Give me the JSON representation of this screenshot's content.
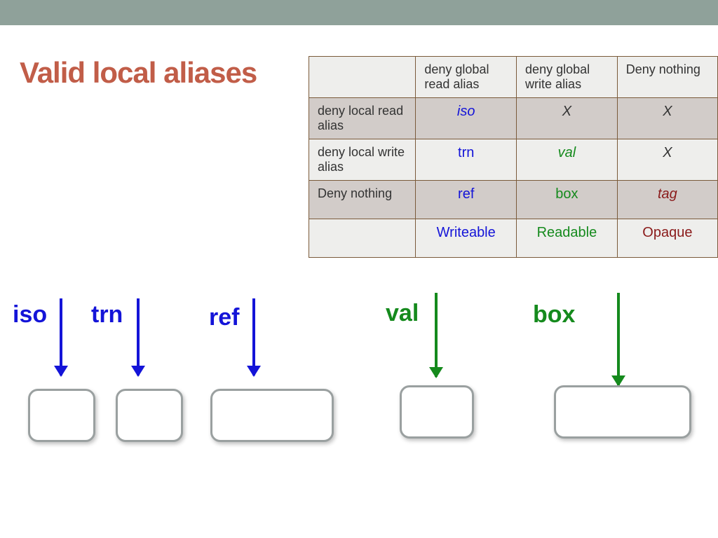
{
  "title": "Valid local aliases",
  "matrix": {
    "col_headers": [
      "deny global read alias",
      "deny global write alias",
      "Deny nothing"
    ],
    "rows": [
      {
        "label": "deny local read alias",
        "cells": [
          {
            "text": "iso",
            "color": "blue",
            "italic": true
          },
          {
            "text": "X",
            "color": "x"
          },
          {
            "text": "X",
            "color": "x"
          }
        ]
      },
      {
        "label": "deny local write alias",
        "cells": [
          {
            "text": "trn",
            "color": "blue"
          },
          {
            "text": "val",
            "color": "green",
            "italic": true
          },
          {
            "text": "X",
            "color": "x"
          }
        ]
      },
      {
        "label": "Deny nothing",
        "cells": [
          {
            "text": "ref",
            "color": "blue"
          },
          {
            "text": "box",
            "color": "green"
          },
          {
            "text": "tag",
            "color": "darkred",
            "italic": true
          }
        ]
      }
    ],
    "footer": [
      {
        "text": "Writeable",
        "color": "blue"
      },
      {
        "text": "Readable",
        "color": "green"
      },
      {
        "text": "Opaque",
        "color": "darkred"
      }
    ]
  },
  "capabilities": {
    "iso": "iso",
    "trn": "trn",
    "ref": "ref",
    "val": "val",
    "box": "box"
  },
  "chart_data": {
    "type": "table",
    "title": "Valid local aliases",
    "columns": [
      "",
      "deny global read alias",
      "deny global write alias",
      "Deny nothing"
    ],
    "rows": [
      [
        "deny local read alias",
        "iso",
        "X",
        "X"
      ],
      [
        "deny local write alias",
        "trn",
        "val",
        "X"
      ],
      [
        "Deny nothing",
        "ref",
        "box",
        "tag"
      ],
      [
        "",
        "Writeable",
        "Readable",
        "Opaque"
      ]
    ]
  }
}
